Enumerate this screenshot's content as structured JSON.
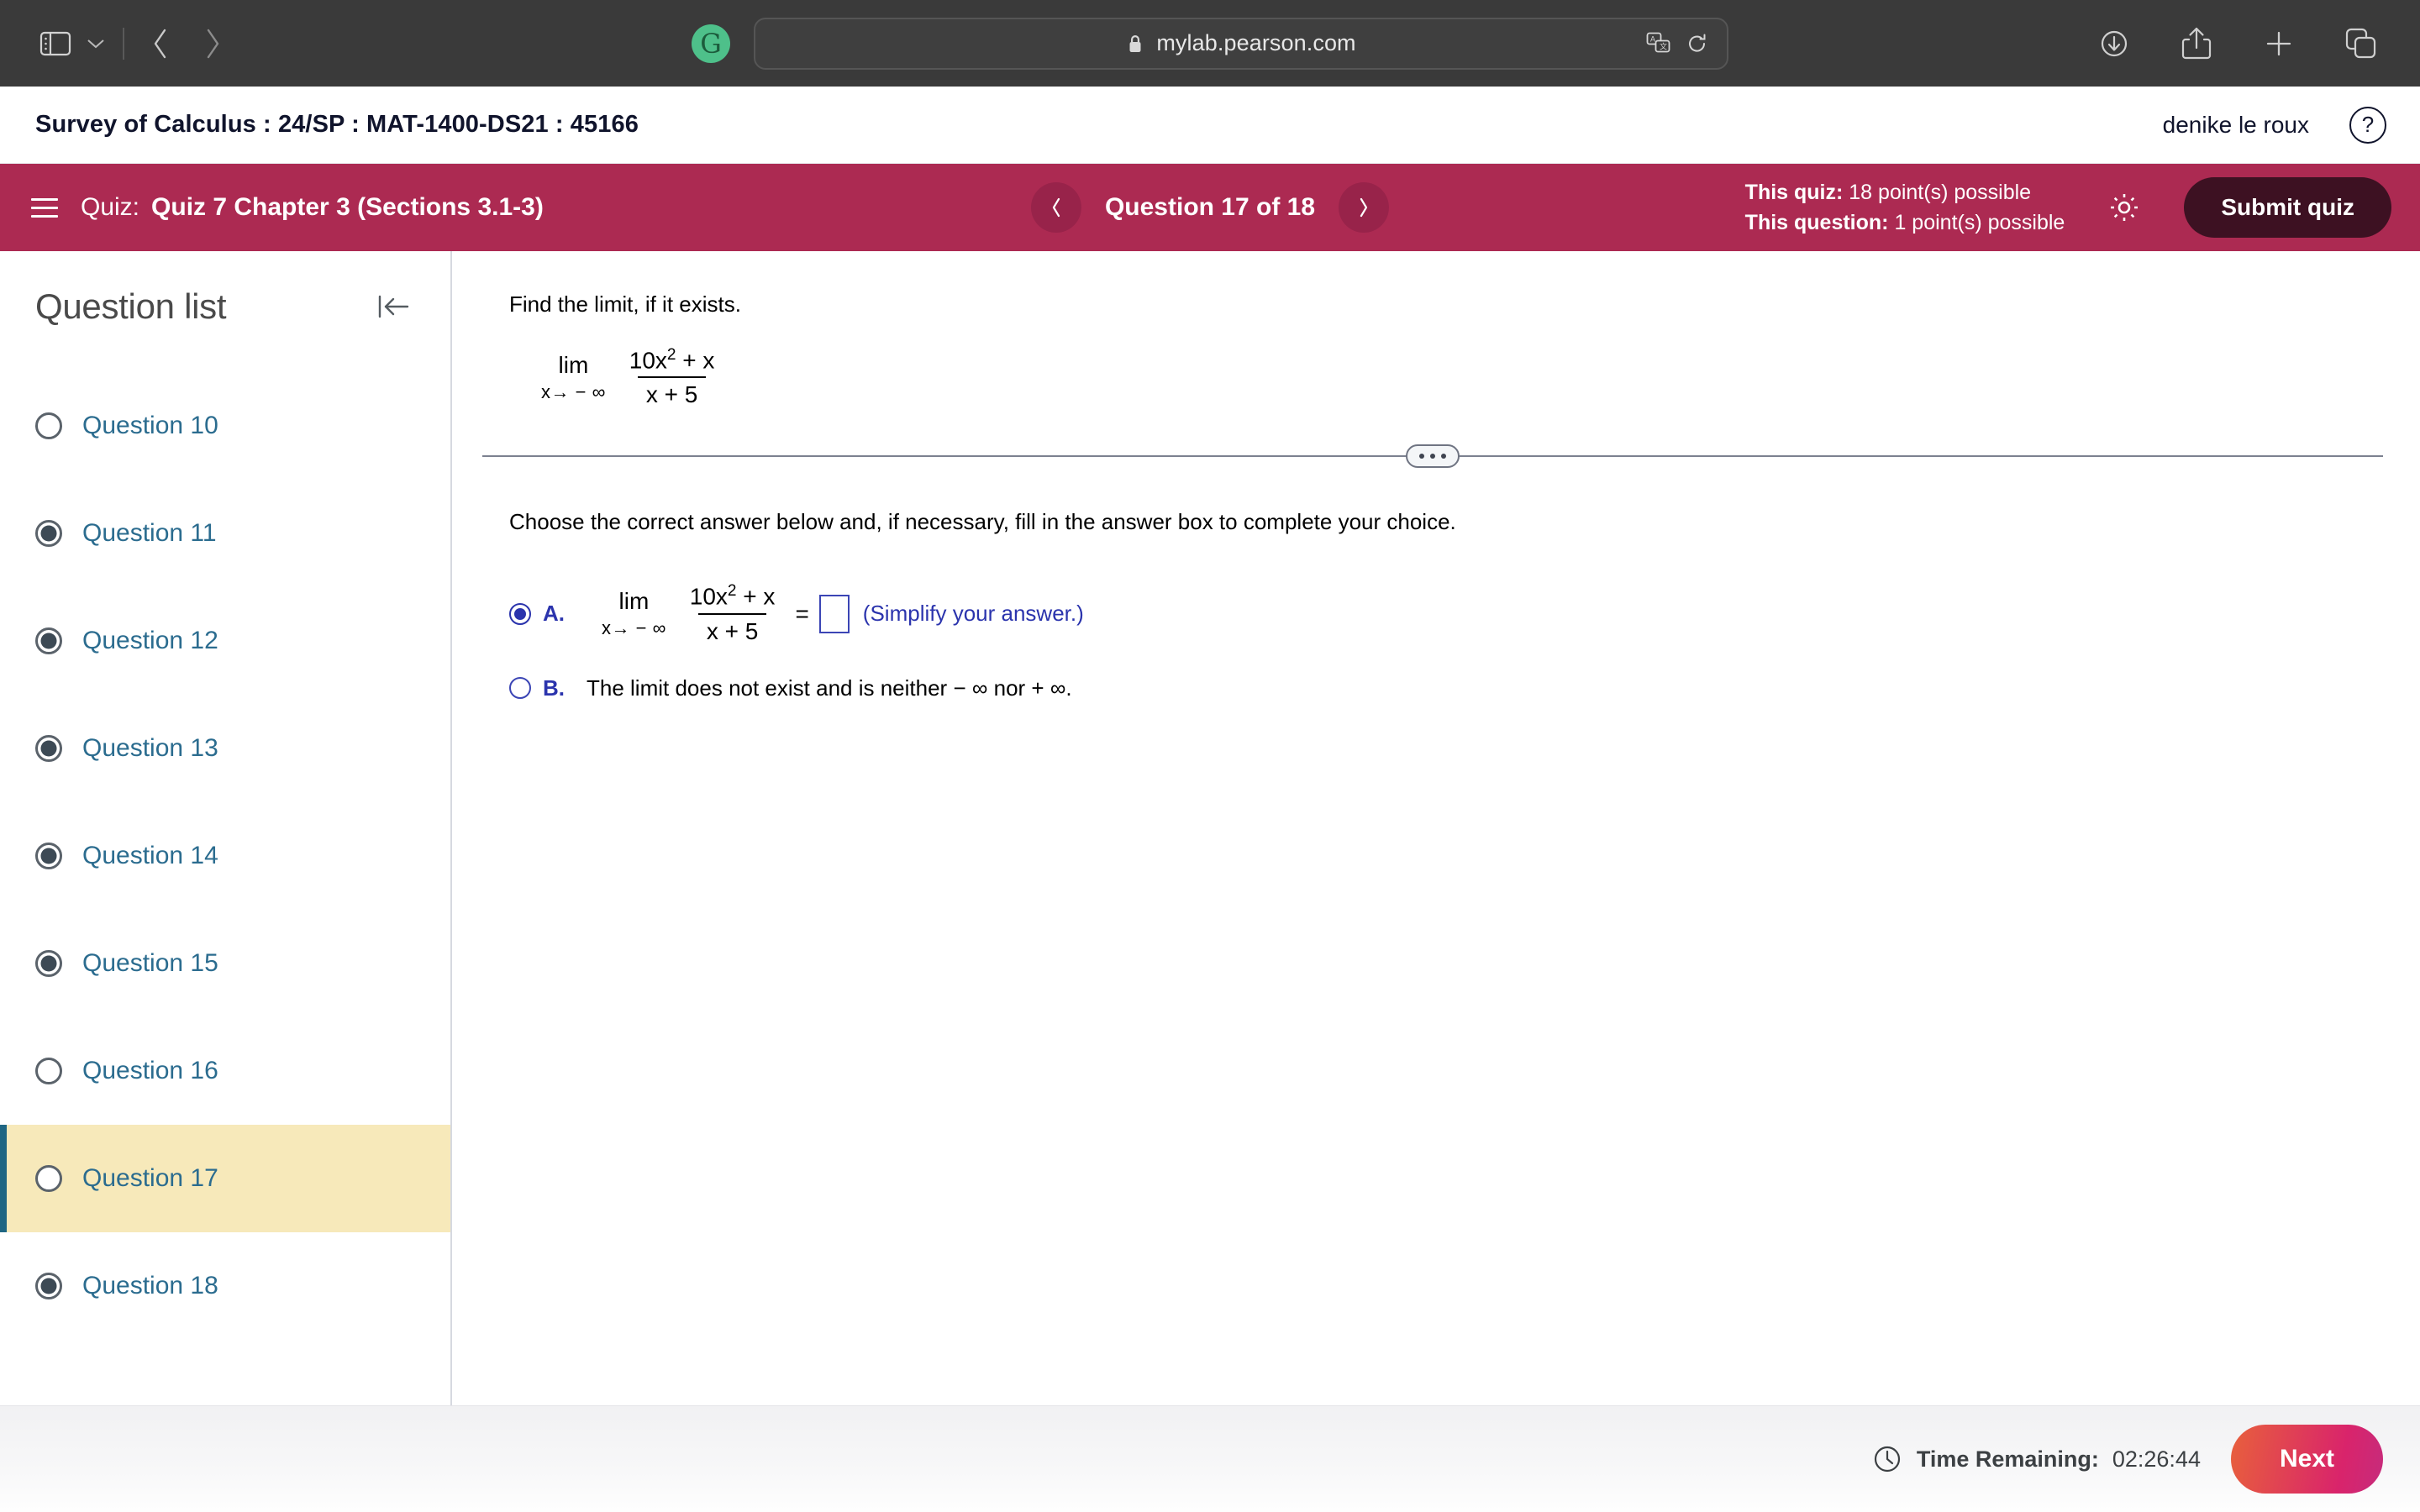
{
  "browser": {
    "url": "mylab.pearson.com",
    "lock_icon": "lock-icon",
    "extension_badge": "G",
    "back_icon": "back-chevron-icon",
    "forward_icon": "forward-chevron-icon",
    "sidebar_icon": "sidebar-toggle-icon",
    "translate_icon": "translate-icon",
    "reload_icon": "reload-icon",
    "download_icon": "downloads-icon",
    "share_icon": "share-icon",
    "new_tab_icon": "new-tab-icon",
    "tabs_icon": "tab-overview-icon"
  },
  "header": {
    "course_title": "Survey of Calculus : 24/SP : MAT-1400-DS21 : 45166",
    "user_name": "denike le roux",
    "help_label": "?"
  },
  "quizbar": {
    "menu_icon": "hamburger-menu-icon",
    "quiz_label": "Quiz:",
    "quiz_name": "Quiz 7 Chapter 3 (Sections 3.1-3)",
    "prev_label": "‹",
    "next_label": "›",
    "question_counter": "Question 17 of 18",
    "quiz_points_label": "This quiz:",
    "quiz_points_value": "18 point(s) possible",
    "question_points_label": "This question:",
    "question_points_value": "1 point(s) possible",
    "settings_icon": "gear-icon",
    "submit_label": "Submit quiz",
    "accent_color": "#ac2a52",
    "submit_bg": "#3d1122"
  },
  "sidebar": {
    "title": "Question list",
    "collapse_icon": "collapse-left-icon",
    "items": [
      {
        "label": "Question 10",
        "answered": false,
        "active": false
      },
      {
        "label": "Question 11",
        "answered": true,
        "active": false
      },
      {
        "label": "Question 12",
        "answered": true,
        "active": false
      },
      {
        "label": "Question 13",
        "answered": true,
        "active": false
      },
      {
        "label": "Question 14",
        "answered": true,
        "active": false
      },
      {
        "label": "Question 15",
        "answered": true,
        "active": false
      },
      {
        "label": "Question 16",
        "answered": false,
        "active": false
      },
      {
        "label": "Question 17",
        "answered": false,
        "active": true
      },
      {
        "label": "Question 18",
        "answered": true,
        "active": false
      }
    ],
    "active_bg": "#f7e9ba",
    "active_border": "#1f6683",
    "link_color": "#2b6c8f"
  },
  "question": {
    "prompt": "Find the limit, if it exists.",
    "limit_lim": "lim",
    "limit_sub": "x→ − ∞",
    "numerator_pre": "10x",
    "numerator_exp": "2",
    "numerator_post": " + x",
    "denominator": "x + 5",
    "divider_handle_icon": "expand-dots-icon",
    "choose_text": "Choose the correct answer below and, if necessary, fill in the answer box to complete your choice.",
    "choices": [
      {
        "letter": "A.",
        "selected": true,
        "type": "math",
        "equals": "=",
        "answer_value": "",
        "note": "(Simplify your answer.)"
      },
      {
        "letter": "B.",
        "selected": false,
        "type": "text",
        "text": "The limit does not exist and is neither − ∞ nor + ∞."
      }
    ]
  },
  "footer": {
    "clock_icon": "clock-icon",
    "time_label": "Time Remaining:",
    "time_value": "02:26:44",
    "next_label": "Next"
  }
}
